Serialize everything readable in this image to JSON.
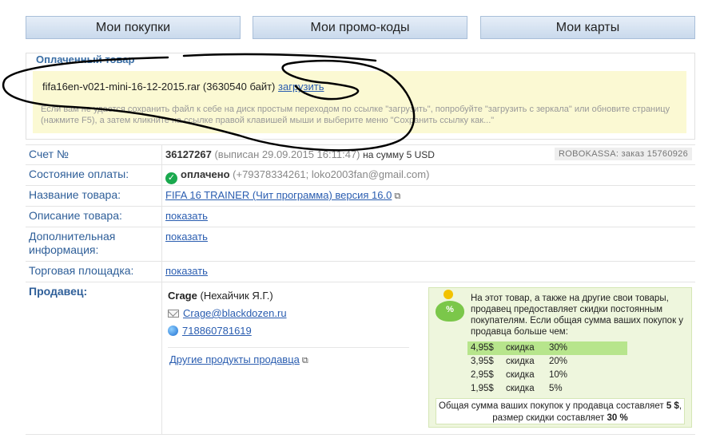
{
  "tabs": [
    {
      "label": "Мои покупки"
    },
    {
      "label": "Мои промо-коды"
    },
    {
      "label": "Мои карты"
    }
  ],
  "paid": {
    "title": "Оплаченный товар",
    "file_name": "fifa16en-v021-mini-16-12-2015.rar",
    "file_size": "(3630540 байт)",
    "download_label": "загрузить",
    "hint": "Если вам не удается сохранить файл к себе на диск простым переходом по ссылке \"загрузить\", попробуйте \"загрузить с зеркала\" или обновите страницу (нажмите F5), а затем кликните на ссылке правой клавишей мыши и выберите меню \"Сохранить ссылку как...\""
  },
  "details": {
    "invoice": {
      "label": "Счет №",
      "number": "36127267",
      "issued": "(выписан 29.09.2015 16:11:47)",
      "sum": "на сумму 5 USD",
      "robokassa": "ROBOKASSA: заказ 15760926"
    },
    "payment": {
      "label": "Состояние оплаты:",
      "status": "оплачено",
      "contacts": "(+79378334261; loko2003fan@gmail.com)"
    },
    "product_name": {
      "label": "Название товара:",
      "value": "FIFA 16 TRAINER (Чит программа) версия 16.0"
    },
    "description": {
      "label": "Описание товара:",
      "value": "показать"
    },
    "extra_info": {
      "label": "Дополнительная информация:",
      "value": "показать"
    },
    "marketplace": {
      "label": "Торговая площадка:",
      "value": "показать"
    },
    "seller": {
      "label": "Продавец",
      "name": "Crage",
      "name_suffix": "(Нехайчик Я.Г.)",
      "email": "Crage@blackdozen.ru",
      "icq": "718860781619",
      "other_products": "Другие продукты продавца"
    }
  },
  "discount": {
    "text": "На этот товар, а также на другие свои товары, продавец предоставляет скидки постоянным покупателям. Если общая сумма ваших покупок у продавца больше чем:",
    "tiers": [
      {
        "price": "4,95$",
        "word": "скидка",
        "pct": "30%",
        "active": true
      },
      {
        "price": "3,95$",
        "word": "скидка",
        "pct": "20%",
        "active": false
      },
      {
        "price": "2,95$",
        "word": "скидка",
        "pct": "10%",
        "active": false
      },
      {
        "price": "1,95$",
        "word": "скидка",
        "pct": "5%",
        "active": false
      }
    ],
    "summary_prefix": "Общая сумма ваших покупок у продавца составляет",
    "summary_amount": "5 $",
    "summary_middle": ", размер скидки составляет",
    "summary_pct": "30 %",
    "pig_pct": "%"
  },
  "colors": {
    "link": "#2a5db0",
    "label": "#2f5f99",
    "paid_ok": "#1aa94e",
    "panel_yellow": "#fbf9d3",
    "discount_bg": "#eef6dd"
  }
}
